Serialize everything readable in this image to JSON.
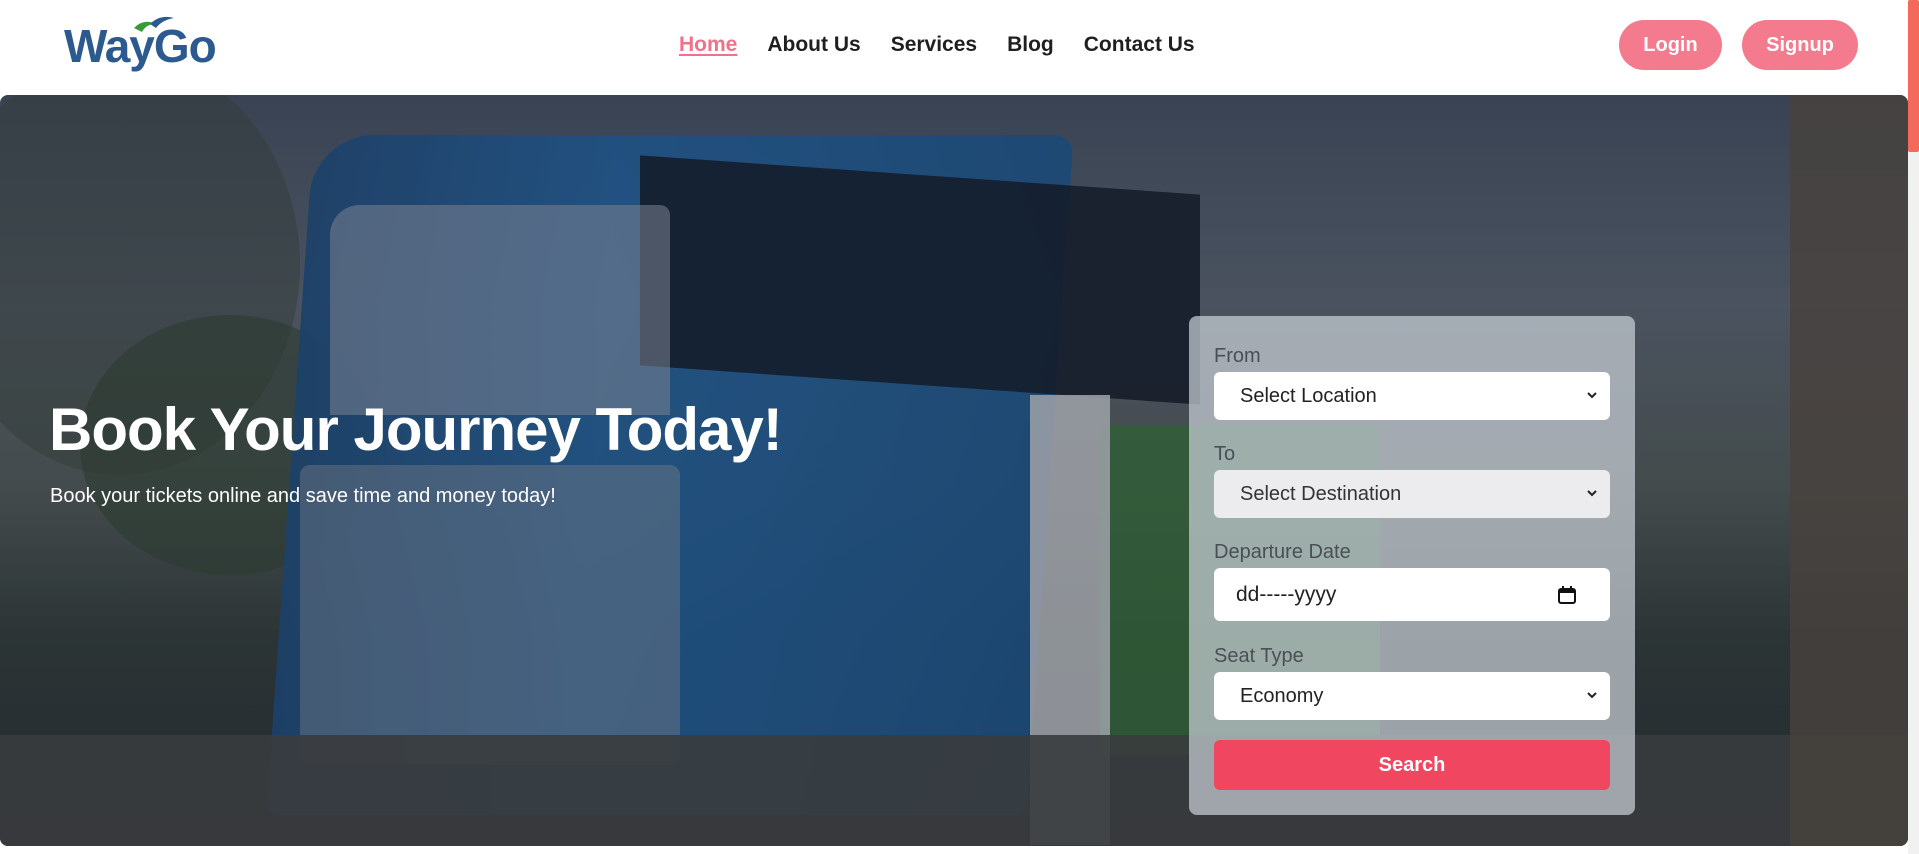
{
  "brand": {
    "name": "WayGo",
    "color": "#2c5a8f",
    "accent": "#3a9a3a"
  },
  "nav": {
    "items": [
      {
        "label": "Home",
        "active": true
      },
      {
        "label": "About Us",
        "active": false
      },
      {
        "label": "Services",
        "active": false
      },
      {
        "label": "Blog",
        "active": false
      },
      {
        "label": "Contact Us",
        "active": false
      }
    ]
  },
  "auth": {
    "login_label": "Login",
    "signup_label": "Signup"
  },
  "hero": {
    "title": "Book Your Journey Today!",
    "subtitle": "Book your tickets online and save time and money today!"
  },
  "form": {
    "from": {
      "label": "From",
      "value": "Select Location"
    },
    "to": {
      "label": "To",
      "value": "Select Destination"
    },
    "date": {
      "label": "Departure Date",
      "value": "dd-----yyyy"
    },
    "seat": {
      "label": "Seat Type",
      "value": "Economy"
    },
    "search_label": "Search"
  },
  "colors": {
    "primary_pink": "#f47b8e",
    "search_red": "#f0465f",
    "nav_active": "#f2708a"
  },
  "icons": {
    "select_chevron": "chevron-down-icon",
    "date_picker": "calendar-icon"
  }
}
